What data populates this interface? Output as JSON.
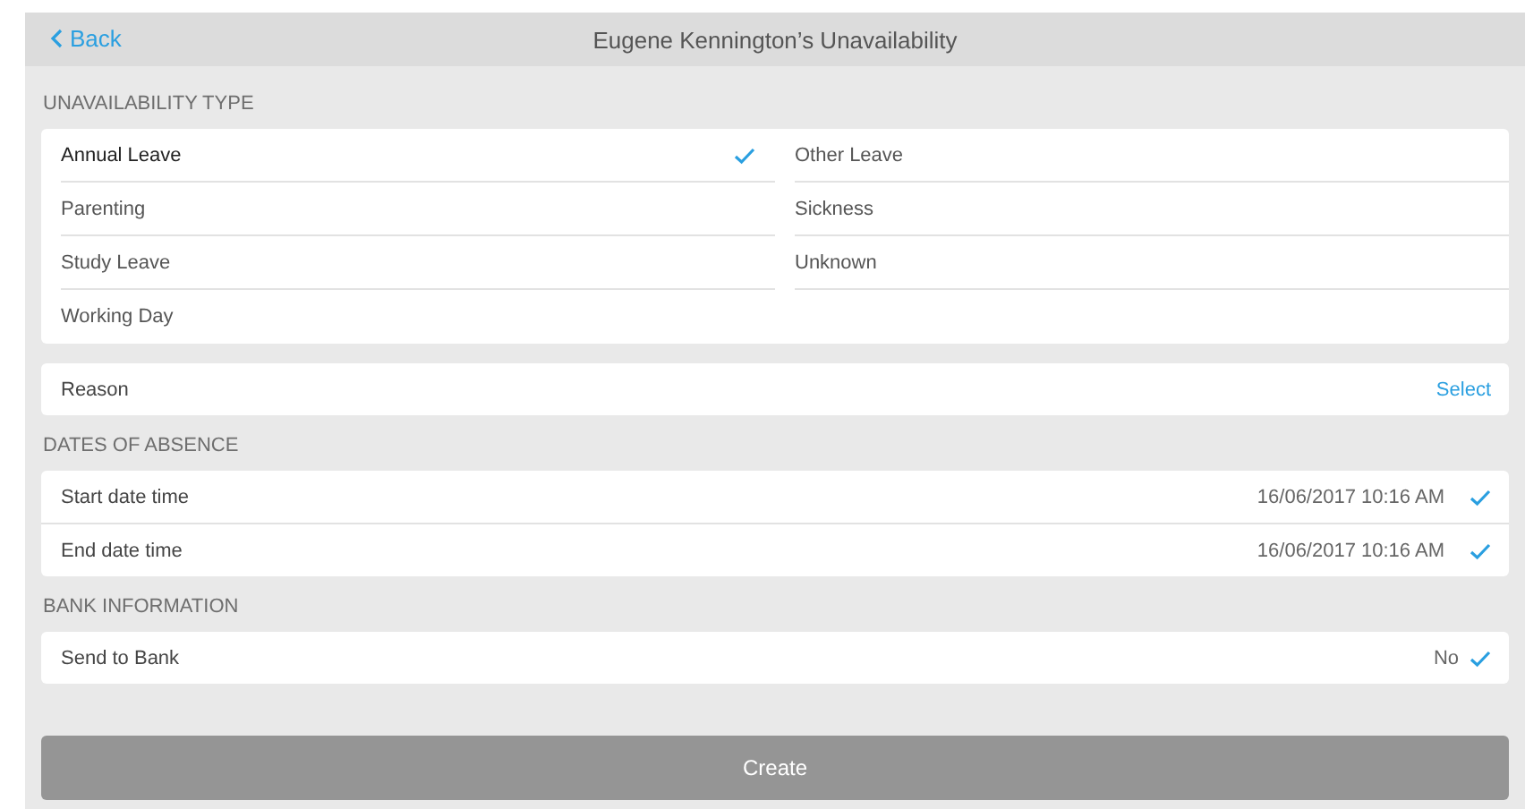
{
  "header": {
    "back": "Back",
    "title": "Eugene Kennington’s Unavailability"
  },
  "unavailability_type": {
    "label": "UNAVAILABILITY TYPE",
    "options": [
      {
        "label": "Annual Leave",
        "selected": true
      },
      {
        "label": "Other Leave",
        "selected": false
      },
      {
        "label": "Parenting",
        "selected": false
      },
      {
        "label": "Sickness",
        "selected": false
      },
      {
        "label": "Study Leave",
        "selected": false
      },
      {
        "label": "Unknown",
        "selected": false
      },
      {
        "label": "Working Day",
        "selected": false
      }
    ]
  },
  "reason": {
    "label": "Reason",
    "action": "Select"
  },
  "dates": {
    "label": "DATES OF ABSENCE",
    "rows": [
      {
        "label": "Start date time",
        "value": "16/06/2017 10:16 AM",
        "checked": true
      },
      {
        "label": "End date time",
        "value": "16/06/2017 10:16 AM",
        "checked": true
      }
    ]
  },
  "bank": {
    "label": "BANK INFORMATION",
    "rows": [
      {
        "label": "Send to Bank",
        "value": "No",
        "checked": true
      }
    ]
  },
  "create_button": {
    "label": "Create",
    "disabled": true
  }
}
